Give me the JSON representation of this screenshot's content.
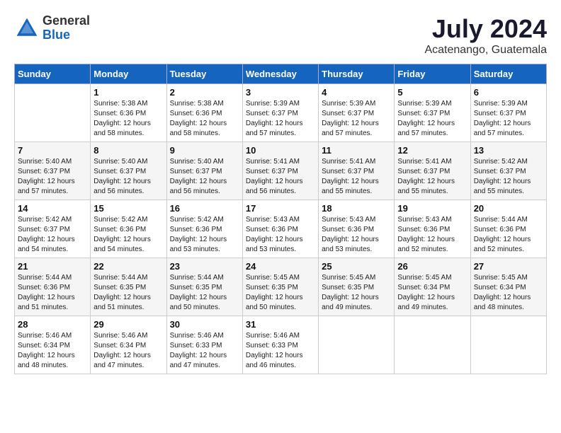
{
  "header": {
    "logo_general": "General",
    "logo_blue": "Blue",
    "title": "July 2024",
    "location": "Acatenango, Guatemala"
  },
  "columns": [
    "Sunday",
    "Monday",
    "Tuesday",
    "Wednesday",
    "Thursday",
    "Friday",
    "Saturday"
  ],
  "weeks": [
    [
      {
        "day": "",
        "sunrise": "",
        "sunset": "",
        "daylight": ""
      },
      {
        "day": "1",
        "sunrise": "Sunrise: 5:38 AM",
        "sunset": "Sunset: 6:36 PM",
        "daylight": "Daylight: 12 hours and 58 minutes."
      },
      {
        "day": "2",
        "sunrise": "Sunrise: 5:38 AM",
        "sunset": "Sunset: 6:36 PM",
        "daylight": "Daylight: 12 hours and 58 minutes."
      },
      {
        "day": "3",
        "sunrise": "Sunrise: 5:39 AM",
        "sunset": "Sunset: 6:37 PM",
        "daylight": "Daylight: 12 hours and 57 minutes."
      },
      {
        "day": "4",
        "sunrise": "Sunrise: 5:39 AM",
        "sunset": "Sunset: 6:37 PM",
        "daylight": "Daylight: 12 hours and 57 minutes."
      },
      {
        "day": "5",
        "sunrise": "Sunrise: 5:39 AM",
        "sunset": "Sunset: 6:37 PM",
        "daylight": "Daylight: 12 hours and 57 minutes."
      },
      {
        "day": "6",
        "sunrise": "Sunrise: 5:39 AM",
        "sunset": "Sunset: 6:37 PM",
        "daylight": "Daylight: 12 hours and 57 minutes."
      }
    ],
    [
      {
        "day": "7",
        "sunrise": "Sunrise: 5:40 AM",
        "sunset": "Sunset: 6:37 PM",
        "daylight": "Daylight: 12 hours and 57 minutes."
      },
      {
        "day": "8",
        "sunrise": "Sunrise: 5:40 AM",
        "sunset": "Sunset: 6:37 PM",
        "daylight": "Daylight: 12 hours and 56 minutes."
      },
      {
        "day": "9",
        "sunrise": "Sunrise: 5:40 AM",
        "sunset": "Sunset: 6:37 PM",
        "daylight": "Daylight: 12 hours and 56 minutes."
      },
      {
        "day": "10",
        "sunrise": "Sunrise: 5:41 AM",
        "sunset": "Sunset: 6:37 PM",
        "daylight": "Daylight: 12 hours and 56 minutes."
      },
      {
        "day": "11",
        "sunrise": "Sunrise: 5:41 AM",
        "sunset": "Sunset: 6:37 PM",
        "daylight": "Daylight: 12 hours and 55 minutes."
      },
      {
        "day": "12",
        "sunrise": "Sunrise: 5:41 AM",
        "sunset": "Sunset: 6:37 PM",
        "daylight": "Daylight: 12 hours and 55 minutes."
      },
      {
        "day": "13",
        "sunrise": "Sunrise: 5:42 AM",
        "sunset": "Sunset: 6:37 PM",
        "daylight": "Daylight: 12 hours and 55 minutes."
      }
    ],
    [
      {
        "day": "14",
        "sunrise": "Sunrise: 5:42 AM",
        "sunset": "Sunset: 6:37 PM",
        "daylight": "Daylight: 12 hours and 54 minutes."
      },
      {
        "day": "15",
        "sunrise": "Sunrise: 5:42 AM",
        "sunset": "Sunset: 6:36 PM",
        "daylight": "Daylight: 12 hours and 54 minutes."
      },
      {
        "day": "16",
        "sunrise": "Sunrise: 5:42 AM",
        "sunset": "Sunset: 6:36 PM",
        "daylight": "Daylight: 12 hours and 53 minutes."
      },
      {
        "day": "17",
        "sunrise": "Sunrise: 5:43 AM",
        "sunset": "Sunset: 6:36 PM",
        "daylight": "Daylight: 12 hours and 53 minutes."
      },
      {
        "day": "18",
        "sunrise": "Sunrise: 5:43 AM",
        "sunset": "Sunset: 6:36 PM",
        "daylight": "Daylight: 12 hours and 53 minutes."
      },
      {
        "day": "19",
        "sunrise": "Sunrise: 5:43 AM",
        "sunset": "Sunset: 6:36 PM",
        "daylight": "Daylight: 12 hours and 52 minutes."
      },
      {
        "day": "20",
        "sunrise": "Sunrise: 5:44 AM",
        "sunset": "Sunset: 6:36 PM",
        "daylight": "Daylight: 12 hours and 52 minutes."
      }
    ],
    [
      {
        "day": "21",
        "sunrise": "Sunrise: 5:44 AM",
        "sunset": "Sunset: 6:36 PM",
        "daylight": "Daylight: 12 hours and 51 minutes."
      },
      {
        "day": "22",
        "sunrise": "Sunrise: 5:44 AM",
        "sunset": "Sunset: 6:35 PM",
        "daylight": "Daylight: 12 hours and 51 minutes."
      },
      {
        "day": "23",
        "sunrise": "Sunrise: 5:44 AM",
        "sunset": "Sunset: 6:35 PM",
        "daylight": "Daylight: 12 hours and 50 minutes."
      },
      {
        "day": "24",
        "sunrise": "Sunrise: 5:45 AM",
        "sunset": "Sunset: 6:35 PM",
        "daylight": "Daylight: 12 hours and 50 minutes."
      },
      {
        "day": "25",
        "sunrise": "Sunrise: 5:45 AM",
        "sunset": "Sunset: 6:35 PM",
        "daylight": "Daylight: 12 hours and 49 minutes."
      },
      {
        "day": "26",
        "sunrise": "Sunrise: 5:45 AM",
        "sunset": "Sunset: 6:34 PM",
        "daylight": "Daylight: 12 hours and 49 minutes."
      },
      {
        "day": "27",
        "sunrise": "Sunrise: 5:45 AM",
        "sunset": "Sunset: 6:34 PM",
        "daylight": "Daylight: 12 hours and 48 minutes."
      }
    ],
    [
      {
        "day": "28",
        "sunrise": "Sunrise: 5:46 AM",
        "sunset": "Sunset: 6:34 PM",
        "daylight": "Daylight: 12 hours and 48 minutes."
      },
      {
        "day": "29",
        "sunrise": "Sunrise: 5:46 AM",
        "sunset": "Sunset: 6:34 PM",
        "daylight": "Daylight: 12 hours and 47 minutes."
      },
      {
        "day": "30",
        "sunrise": "Sunrise: 5:46 AM",
        "sunset": "Sunset: 6:33 PM",
        "daylight": "Daylight: 12 hours and 47 minutes."
      },
      {
        "day": "31",
        "sunrise": "Sunrise: 5:46 AM",
        "sunset": "Sunset: 6:33 PM",
        "daylight": "Daylight: 12 hours and 46 minutes."
      },
      {
        "day": "",
        "sunrise": "",
        "sunset": "",
        "daylight": ""
      },
      {
        "day": "",
        "sunrise": "",
        "sunset": "",
        "daylight": ""
      },
      {
        "day": "",
        "sunrise": "",
        "sunset": "",
        "daylight": ""
      }
    ]
  ]
}
